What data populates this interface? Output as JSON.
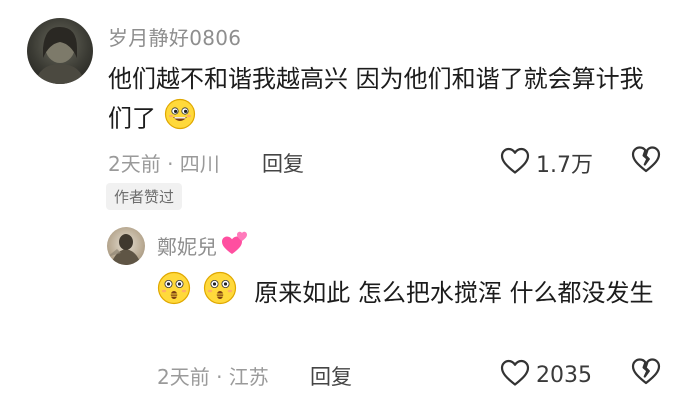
{
  "comment": {
    "username": "岁月静好0806",
    "text": "他们越不和谐我越高兴  因为他们和谐了就会算计我们了",
    "trailing_emoji_icon": "grinning-face-icon",
    "meta": "2天前 · 四川",
    "reply_label": "回复",
    "like_count": "1.7万",
    "author_badge": "作者赞过"
  },
  "reply": {
    "username": "鄭妮兒",
    "name_emoji_icon": "two-hearts-icon",
    "leading_emoji_icons": [
      "zipper-mouth-surprised-icon",
      "zipper-mouth-surprised-icon"
    ],
    "text": "原来如此  怎么把水搅浑  什么都没发生",
    "meta": "2天前 · 江苏",
    "reply_label": "回复",
    "like_count": "2035"
  },
  "colors": {
    "username": "#8e8e8e",
    "meta": "#9a9a9a",
    "body_text": "#1c1c1c",
    "emoji_yellow": "#ffd93b",
    "heart_pink": "#ff4fa0"
  }
}
